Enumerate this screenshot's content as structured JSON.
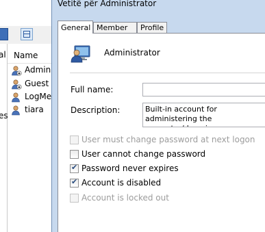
{
  "dialog": {
    "title": "Vetitë për Administrator",
    "tabs": [
      {
        "label": "General",
        "active": true
      },
      {
        "label": "Member Of",
        "active": false
      },
      {
        "label": "Profile",
        "active": false
      }
    ],
    "user_name": "Administrator",
    "full_name_label": "Full name:",
    "full_name_value": "",
    "description_label": "Description:",
    "description_value": "Built-in account for administering the\ncomputer/domain",
    "checkboxes": [
      {
        "label": "User must change password at next logon",
        "checked": false,
        "enabled": false
      },
      {
        "label": "User cannot change password",
        "checked": false,
        "enabled": true
      },
      {
        "label": "Password never expires",
        "checked": true,
        "enabled": true
      },
      {
        "label": "Account is disabled",
        "checked": true,
        "enabled": true
      },
      {
        "label": "Account is locked out",
        "checked": false,
        "enabled": false
      }
    ]
  },
  "background_window": {
    "left_fragments": [
      "al",
      "es"
    ],
    "list_header": "Name",
    "users": [
      {
        "label": "Admini",
        "icon": "user-disabled-icon"
      },
      {
        "label": "Guest",
        "icon": "user-icon"
      },
      {
        "label": "LogMe",
        "icon": "user-icon"
      },
      {
        "label": "tiara",
        "icon": "user-icon"
      }
    ]
  },
  "colors": {
    "dialog_frame": "#c7d9ee",
    "checkmark": "#2a4d7f",
    "disabled_text": "#9c9c9c"
  }
}
